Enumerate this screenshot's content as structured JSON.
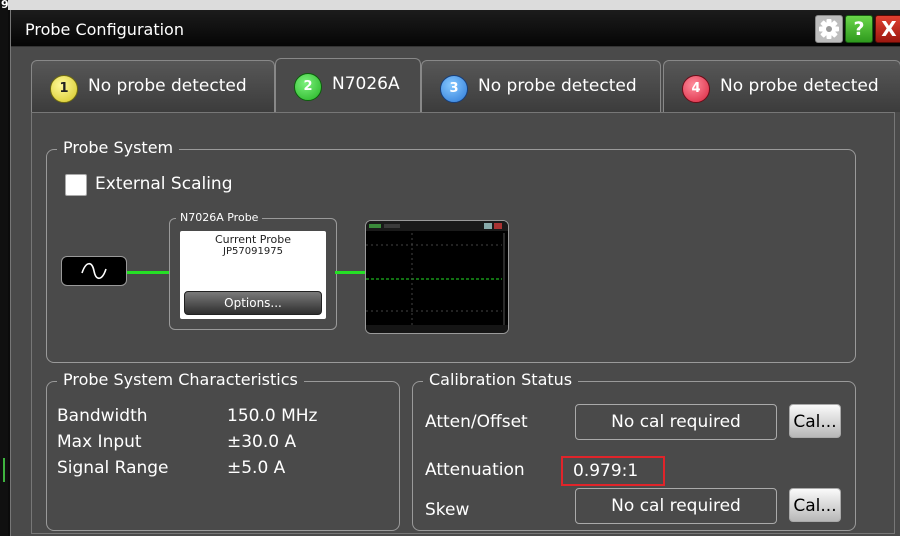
{
  "edge": {
    "number": "9"
  },
  "window": {
    "title": "Probe Configuration",
    "help_label": "?",
    "close_label": "X"
  },
  "tabs": [
    {
      "badge": "1",
      "label": "No probe detected",
      "active": false,
      "color": "#d4c624"
    },
    {
      "badge": "2",
      "label": "N7026A",
      "active": true,
      "color": "#23b323"
    },
    {
      "badge": "3",
      "label": "No probe detected",
      "active": false,
      "color": "#2d7ad8"
    },
    {
      "badge": "4",
      "label": "No probe detected",
      "active": false,
      "color": "#d8243e"
    }
  ],
  "probe_system": {
    "title": "Probe System",
    "external_scaling_label": "External Scaling",
    "external_scaling_checked": false,
    "probe_box_title": "N7026A Probe",
    "current_probe_label": "Current Probe",
    "serial": "JP57091975",
    "options_label": "Options..."
  },
  "characteristics": {
    "title": "Probe System Characteristics",
    "rows": [
      {
        "label": "Bandwidth",
        "value": "150.0 MHz"
      },
      {
        "label": "Max Input",
        "value": "±30.0 A"
      },
      {
        "label": "Signal Range",
        "value": "±5.0 A"
      }
    ]
  },
  "calibration": {
    "title": "Calibration Status",
    "atten_offset_label": "Atten/Offset",
    "atten_offset_status": "No cal required",
    "attenuation_label": "Attenuation",
    "attenuation_value": "0.979:1",
    "skew_label": "Skew",
    "skew_status": "No cal required",
    "cal_button_label": "Cal..."
  },
  "colors": {
    "trace": "#25e025",
    "highlight": "#e0242a",
    "panel": "#4a4a4a"
  }
}
